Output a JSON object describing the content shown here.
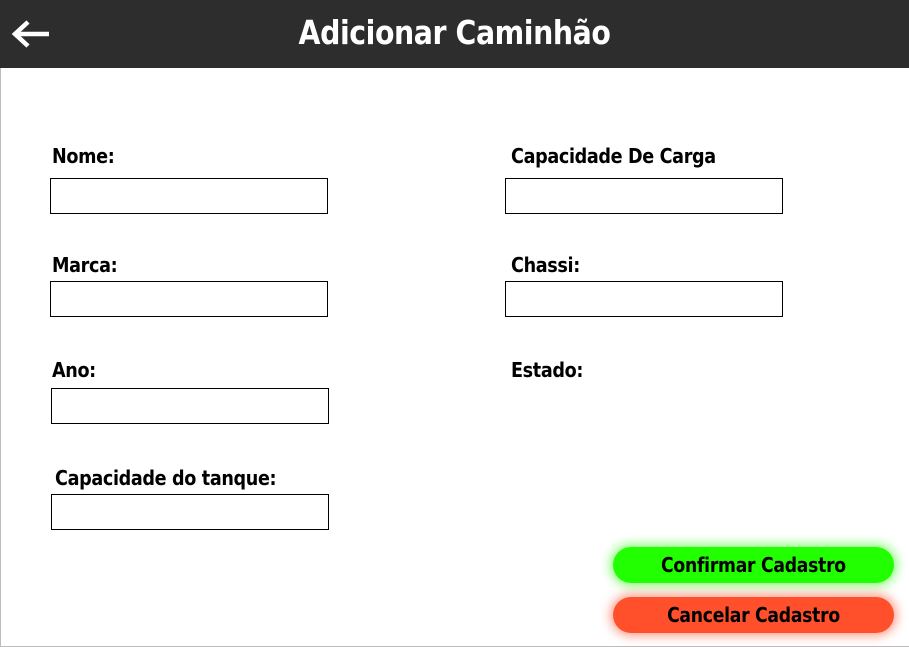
{
  "header": {
    "title": "Adicionar Caminhão",
    "back_icon": "arrow-left-icon"
  },
  "form": {
    "left": {
      "nome_label": "Nome:",
      "marca_label": "Marca:",
      "ano_label": "Ano:",
      "tanque_label": "Capacidade do tanque:"
    },
    "right": {
      "carga_label": "Capacidade De Carga",
      "chassi_label": "Chassi:",
      "estado_label": "Estado:"
    },
    "values": {
      "nome": "",
      "marca": "",
      "ano": "",
      "tanque": "",
      "carga": "",
      "chassi": ""
    }
  },
  "actions": {
    "confirm_label": "Confirmar Cadastro",
    "cancel_label": "Cancelar Cadastro"
  },
  "colors": {
    "header_bg": "#2d2d2d",
    "confirm": "#22ff00",
    "cancel": "#ff4f2b"
  }
}
